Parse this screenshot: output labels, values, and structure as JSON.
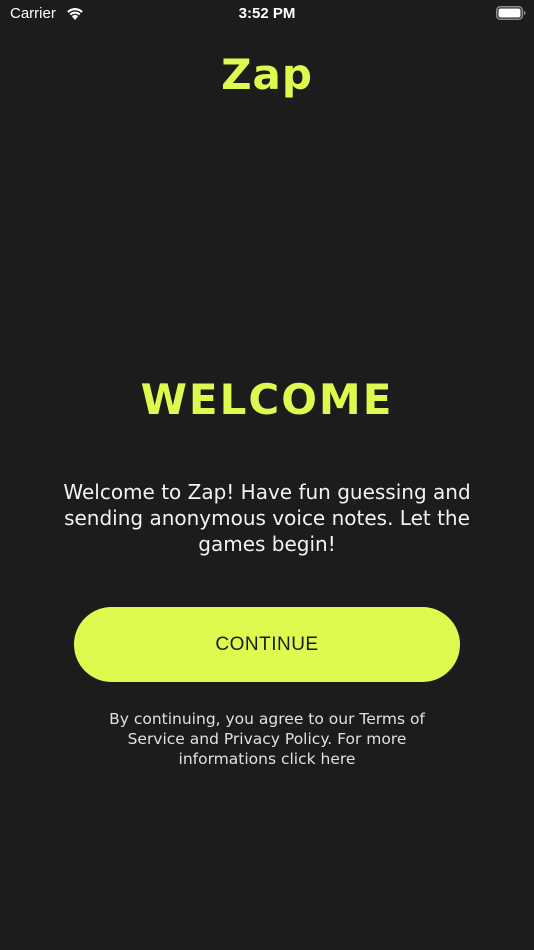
{
  "status_bar": {
    "carrier": "Carrier",
    "time": "3:52 PM",
    "wifi_icon": "wifi-icon",
    "battery_icon": "battery-icon"
  },
  "app": {
    "logo": "Zap",
    "accent_color": "#ddfb4f",
    "background_color": "#1c1c1c"
  },
  "main": {
    "title": "WELCOME",
    "description": "Welcome to Zap! Have fun guessing and sending anonymous voice notes. Let the games begin!",
    "continue_label": "CONTINUE",
    "terms": "By continuing, you agree to our Terms of Service and Privacy Policy. For more informations click here"
  }
}
